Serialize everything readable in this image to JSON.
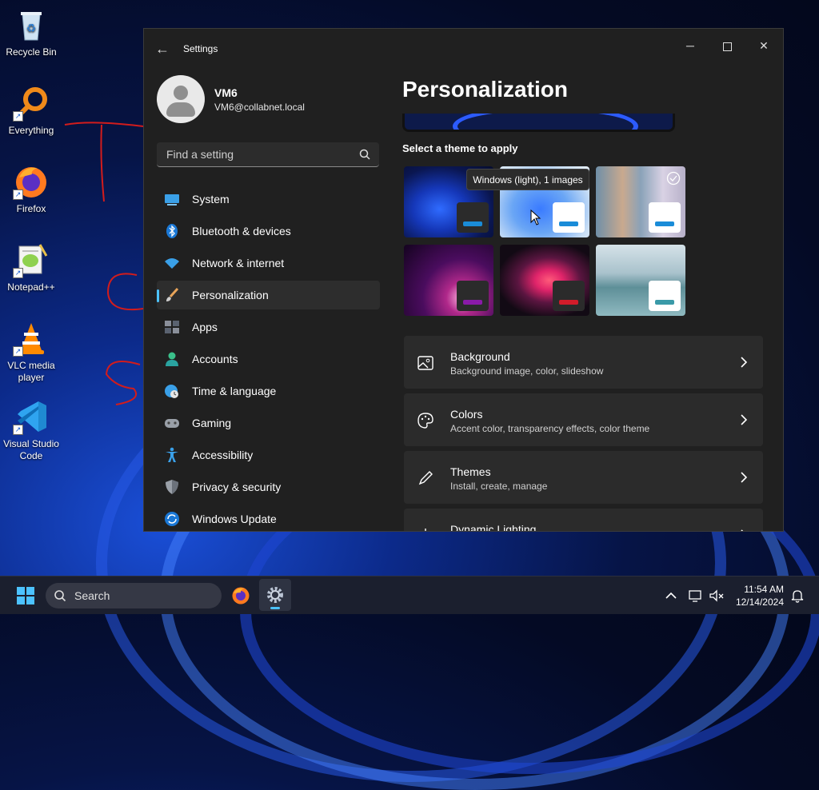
{
  "desktop": {
    "icons": [
      {
        "label": "Recycle Bin",
        "icon": "recycle-bin-icon"
      },
      {
        "label": "Everything",
        "icon": "everything-search-icon"
      },
      {
        "label": "Firefox",
        "icon": "firefox-icon"
      },
      {
        "label": "Notepad++",
        "icon": "notepad-plus-plus-icon"
      },
      {
        "label": "VLC media player",
        "icon": "vlc-icon"
      },
      {
        "label": "Visual Studio Code",
        "icon": "vscode-icon"
      }
    ]
  },
  "window": {
    "title": "Settings",
    "controls": [
      "minimize",
      "maximize",
      "close"
    ]
  },
  "profile": {
    "name": "VM6",
    "email": "VM6@collabnet.local"
  },
  "search": {
    "placeholder": "Find a setting"
  },
  "nav": {
    "items": [
      {
        "label": "System",
        "icon": "system-icon"
      },
      {
        "label": "Bluetooth & devices",
        "icon": "bluetooth-icon"
      },
      {
        "label": "Network & internet",
        "icon": "wifi-icon"
      },
      {
        "label": "Personalization",
        "icon": "brush-icon",
        "active": true
      },
      {
        "label": "Apps",
        "icon": "apps-icon"
      },
      {
        "label": "Accounts",
        "icon": "accounts-icon"
      },
      {
        "label": "Time & language",
        "icon": "globe-clock-icon"
      },
      {
        "label": "Gaming",
        "icon": "gamepad-icon"
      },
      {
        "label": "Accessibility",
        "icon": "accessibility-icon"
      },
      {
        "label": "Privacy & security",
        "icon": "shield-icon"
      },
      {
        "label": "Windows Update",
        "icon": "update-icon"
      }
    ]
  },
  "main": {
    "title": "Personalization",
    "theme_section_label": "Select a theme to apply",
    "tooltip": "Windows (light), 1 images",
    "cards": [
      {
        "title": "Background",
        "subtitle": "Background image, color, slideshow",
        "icon": "image-icon"
      },
      {
        "title": "Colors",
        "subtitle": "Accent color, transparency effects, color theme",
        "icon": "palette-icon"
      },
      {
        "title": "Themes",
        "subtitle": "Install, create, manage",
        "icon": "pen-icon"
      },
      {
        "title": "Dynamic Lighting",
        "subtitle": "",
        "icon": "dynamic-lighting-icon"
      }
    ]
  },
  "taskbar": {
    "search_label": "Search",
    "time": "11:54 AM",
    "date": "12/14/2024"
  },
  "colors": {
    "accent": "#4cc2ff",
    "window_bg": "#202020",
    "card_bg": "#2b2b2b"
  }
}
